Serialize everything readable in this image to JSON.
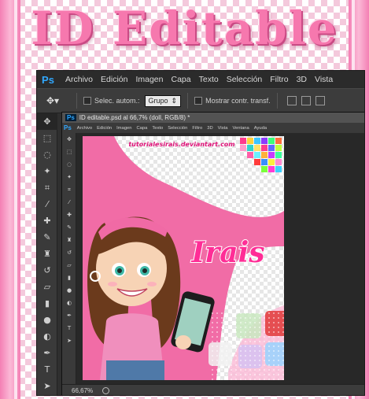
{
  "banner": {
    "title": "ID Editable"
  },
  "menubar": {
    "logo": "Ps",
    "items": [
      "Archivo",
      "Edición",
      "Imagen",
      "Capa",
      "Texto",
      "Selección",
      "Filtro",
      "3D",
      "Vista"
    ]
  },
  "options": {
    "checkbox_label": "Selec. autom.:",
    "dropdown_value": "Grupo",
    "transform_label": "Mostrar contr. transf."
  },
  "document": {
    "title": "ID editable.psd al 66,7% (doll, RGB/8) *",
    "logo": "Ps",
    "inner_menu": [
      "Archivo",
      "Edición",
      "Imagen",
      "Capa",
      "Texto",
      "Selección",
      "Filtro",
      "3D",
      "Vista",
      "Ventana",
      "Ayuda"
    ],
    "zoom": "66,67%"
  },
  "canvas": {
    "watermark": "tutorialesirais.deviantart.com",
    "name": "Irais"
  },
  "colors": {
    "pink": "#f16ca6",
    "pink_light": "#fbb9d6",
    "ps_blue": "#31a8ff"
  }
}
